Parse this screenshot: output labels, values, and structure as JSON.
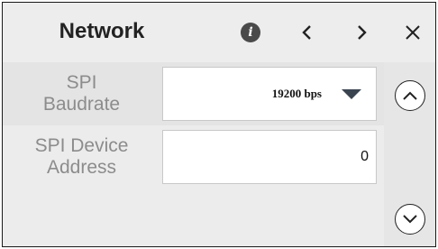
{
  "header": {
    "title": "Network",
    "icons": {
      "info": "info-icon",
      "prev": "chevron-left-icon",
      "next": "chevron-right-icon",
      "close": "close-icon"
    }
  },
  "fields": [
    {
      "label_line1": "SPI",
      "label_line2": "Baudrate",
      "type": "select",
      "value": "19200 bps"
    },
    {
      "label_line1": "SPI Device",
      "label_line2": "Address",
      "type": "input",
      "value": "0"
    }
  ],
  "scroll": {
    "up_icon": "chevron-up-icon",
    "down_icon": "chevron-down-icon"
  },
  "colors": {
    "header_bg": "#ededed",
    "label_text": "#8c8c8c",
    "row_alt_bg": "#e4e4e4"
  }
}
